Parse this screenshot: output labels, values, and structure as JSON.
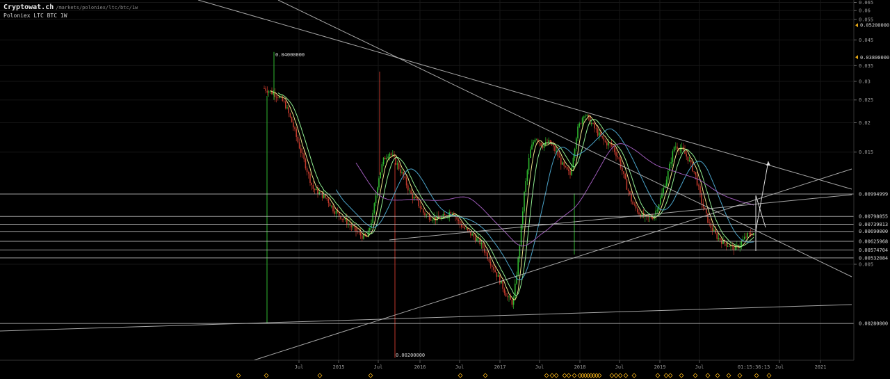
{
  "header": {
    "site": "Cryptowat.ch",
    "path": "/markets/poloniex/ltc/btc/1w",
    "market": "Poloniex LTC BTC 1W"
  },
  "chart_data": {
    "type": "candlestick",
    "y_scale": "log",
    "y_tick_labels": [
      "0.065",
      "0.06",
      "0.055",
      "0.045",
      "0.035",
      "0.03",
      "0.025",
      "0.02",
      "0.015",
      "0.005"
    ],
    "x_tick_labels": [
      "Jul",
      "2015",
      "Jul",
      "2016",
      "Jul",
      "2017",
      "Jul",
      "2018",
      "Jul",
      "2019",
      "Jul",
      "Jul",
      "2021"
    ],
    "current_time": "01:15:36:13",
    "price_lines": [
      "0.00994999",
      "0.00798855",
      "0.00739813",
      "0.00690000",
      "0.00625968",
      "0.00574704",
      "0.00532084",
      "0.00280000"
    ],
    "price_markers": [
      "0.05200000",
      "0.03800000"
    ],
    "annotations": [
      "0.04000000",
      "0.00200000"
    ],
    "colors": {
      "up": "#2fb82f",
      "down": "#c0392b",
      "ma_fast": "#f0e68c",
      "ma_mid": "#90ee90",
      "ma_slow": "#4aa3c9",
      "ma_long": "#9b59b6",
      "lines": "#cfcfcf",
      "marker": "#e6a817"
    }
  }
}
